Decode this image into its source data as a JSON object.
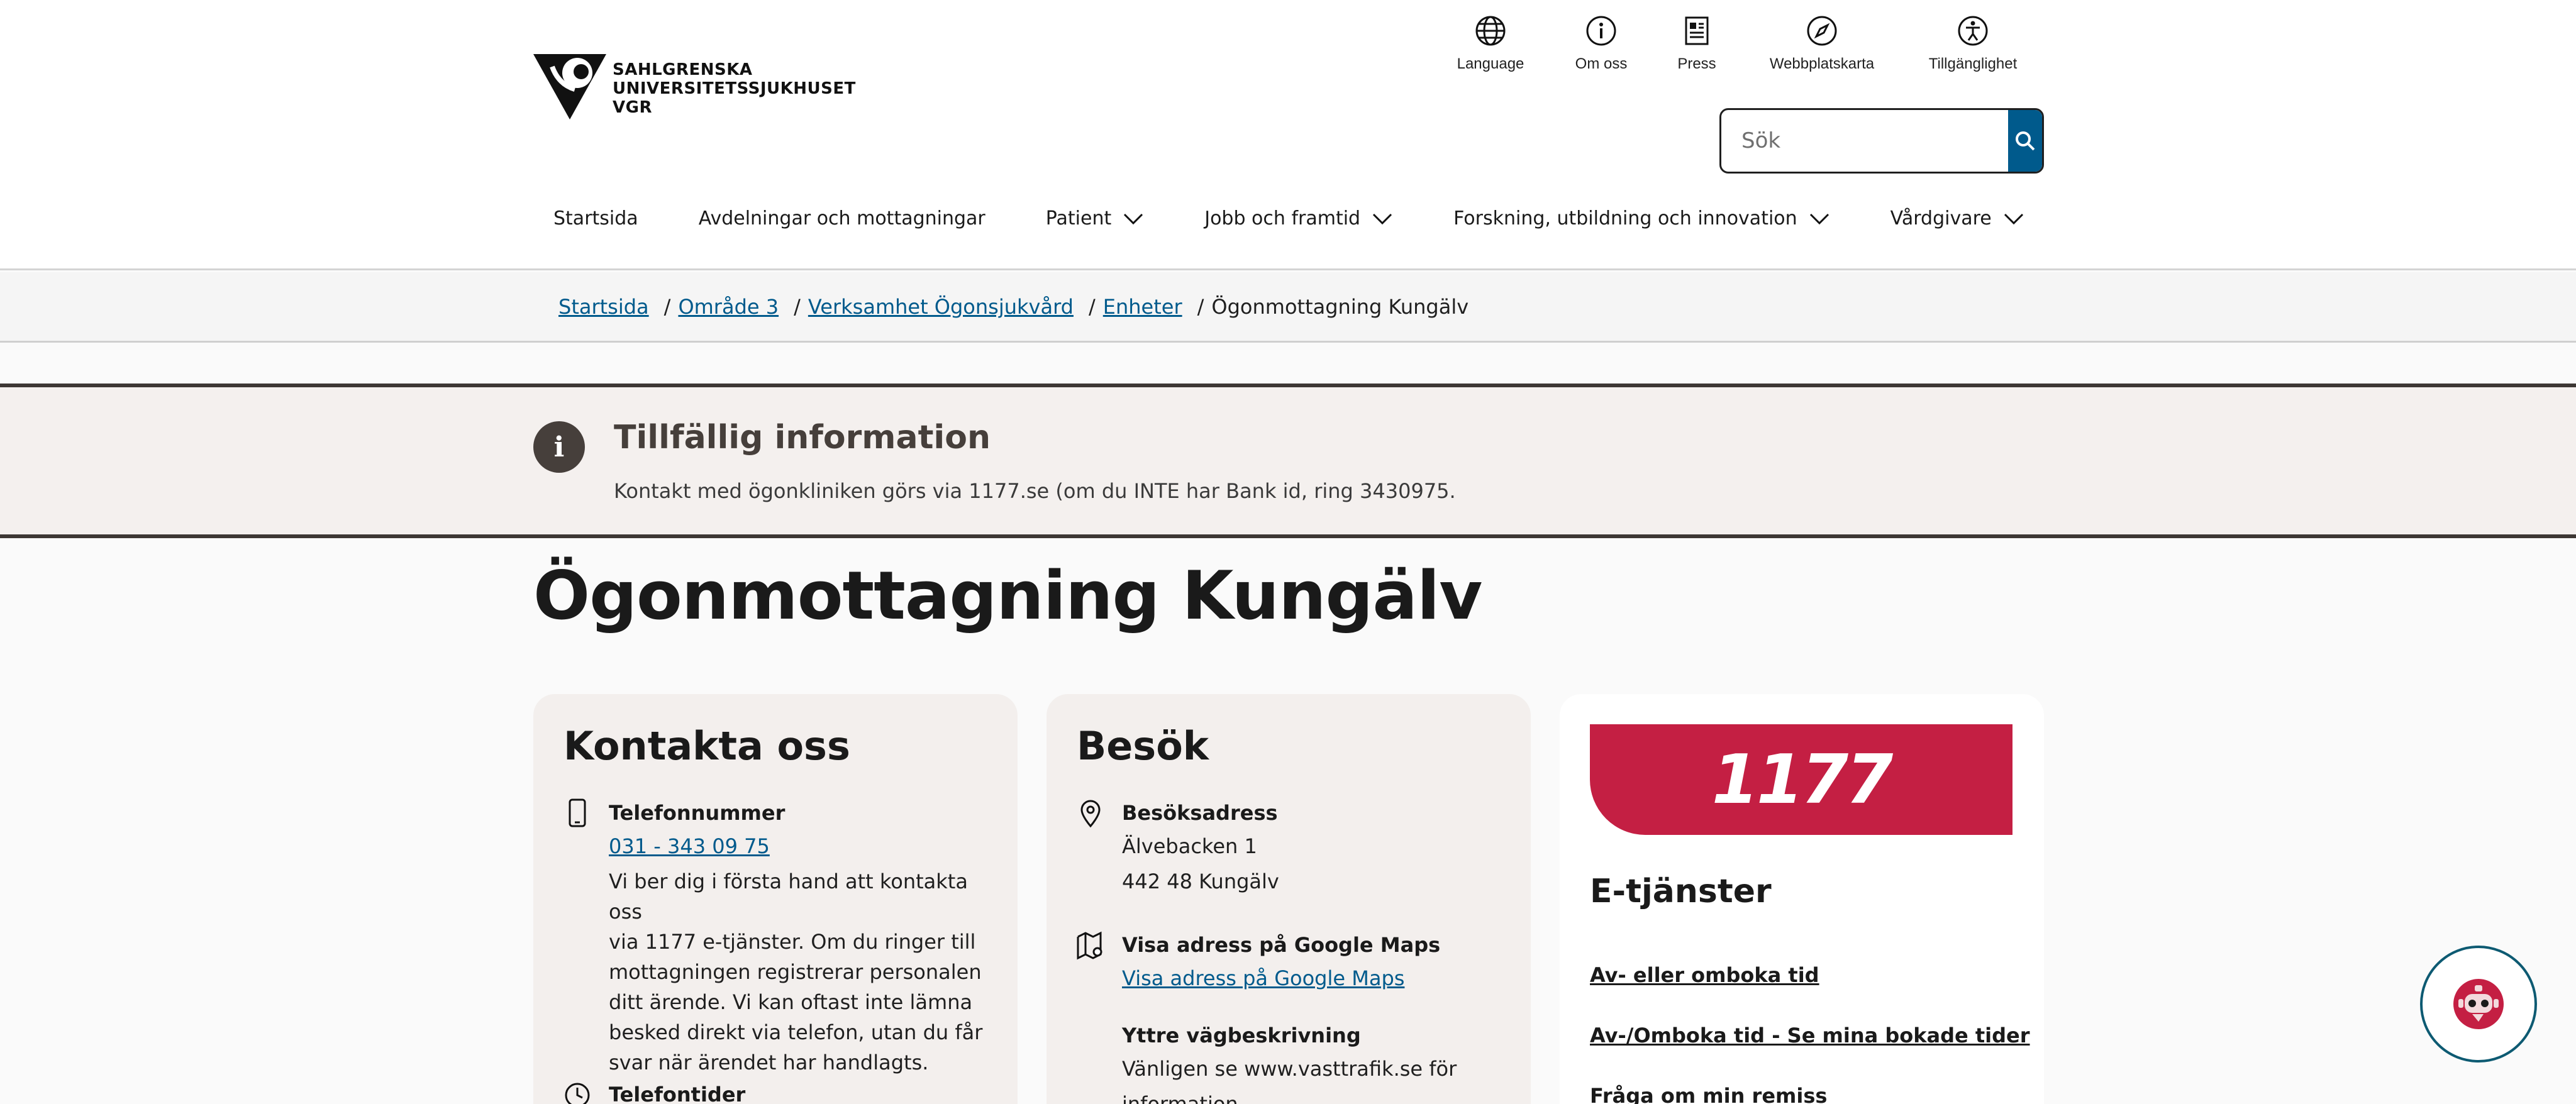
{
  "header": {
    "logo_lines": [
      "SAHLGRENSKA",
      "UNIVERSITETSSJUKHUSET",
      "VGR"
    ],
    "utility": [
      {
        "label": "Language",
        "icon": "globe-icon"
      },
      {
        "label": "Om oss",
        "icon": "info-icon"
      },
      {
        "label": "Press",
        "icon": "newspaper-icon"
      },
      {
        "label": "Webbplatskarta",
        "icon": "compass-icon"
      },
      {
        "label": "Tillgänglighet",
        "icon": "accessibility-icon"
      }
    ],
    "search": {
      "placeholder": "Sök",
      "button_icon": "search-icon"
    },
    "nav": [
      {
        "label": "Startsida",
        "dropdown": false
      },
      {
        "label": "Avdelningar och mottagningar",
        "dropdown": false
      },
      {
        "label": "Patient",
        "dropdown": true
      },
      {
        "label": "Jobb och framtid",
        "dropdown": true
      },
      {
        "label": "Forskning, utbildning och innovation",
        "dropdown": true
      },
      {
        "label": "Vårdgivare",
        "dropdown": true
      }
    ]
  },
  "breadcrumb": {
    "items": [
      "Startsida",
      "Område 3",
      "Verksamhet Ögonsjukvård",
      "Enheter"
    ],
    "separator": "/",
    "current": "Ögonmottagning Kungälv"
  },
  "alert": {
    "title": "Tillfällig information",
    "text": "Kontakt med ögonkliniken görs via 1177.se (om du INTE har Bank id, ring 3430975.",
    "icon": "info-icon"
  },
  "page_title": "Ögonmottagning Kungälv",
  "contact": {
    "title": "Kontakta oss",
    "phone_label": "Telefonnummer",
    "phone_value": "031 - 343 09 75",
    "phone_desc_lines": [
      "Vi ber dig i första hand att kontakta oss",
      "via 1177 e-tjänster. Om du ringer till",
      "mottagningen registrerar personalen",
      "ditt ärende. Vi kan oftast inte lämna",
      "besked direkt via telefon, utan du får",
      "svar när ärendet har handlagts."
    ],
    "hours_label": "Telefontider"
  },
  "visit": {
    "title": "Besök",
    "address_label": "Besöksadress",
    "address_lines": [
      "Älvebacken 1",
      "442 48 Kungälv"
    ],
    "maps_label": "Visa adress på Google Maps",
    "maps_link": "Visa adress på Google Maps",
    "directions_label": "Yttre vägbeskrivning",
    "directions_lines": [
      "Vänligen se www.vasttrafik.se för",
      "information"
    ]
  },
  "etj": {
    "banner": "1177",
    "title": "E-tjänster",
    "links": [
      "Av- eller omboka tid",
      "Av-/Omboka tid - Se mina bokade tider",
      "Fråga om min remiss"
    ]
  },
  "colors": {
    "brand_blue": "#005a8c",
    "red_1177": "#c41f43",
    "alert_border": "#3d3734"
  }
}
